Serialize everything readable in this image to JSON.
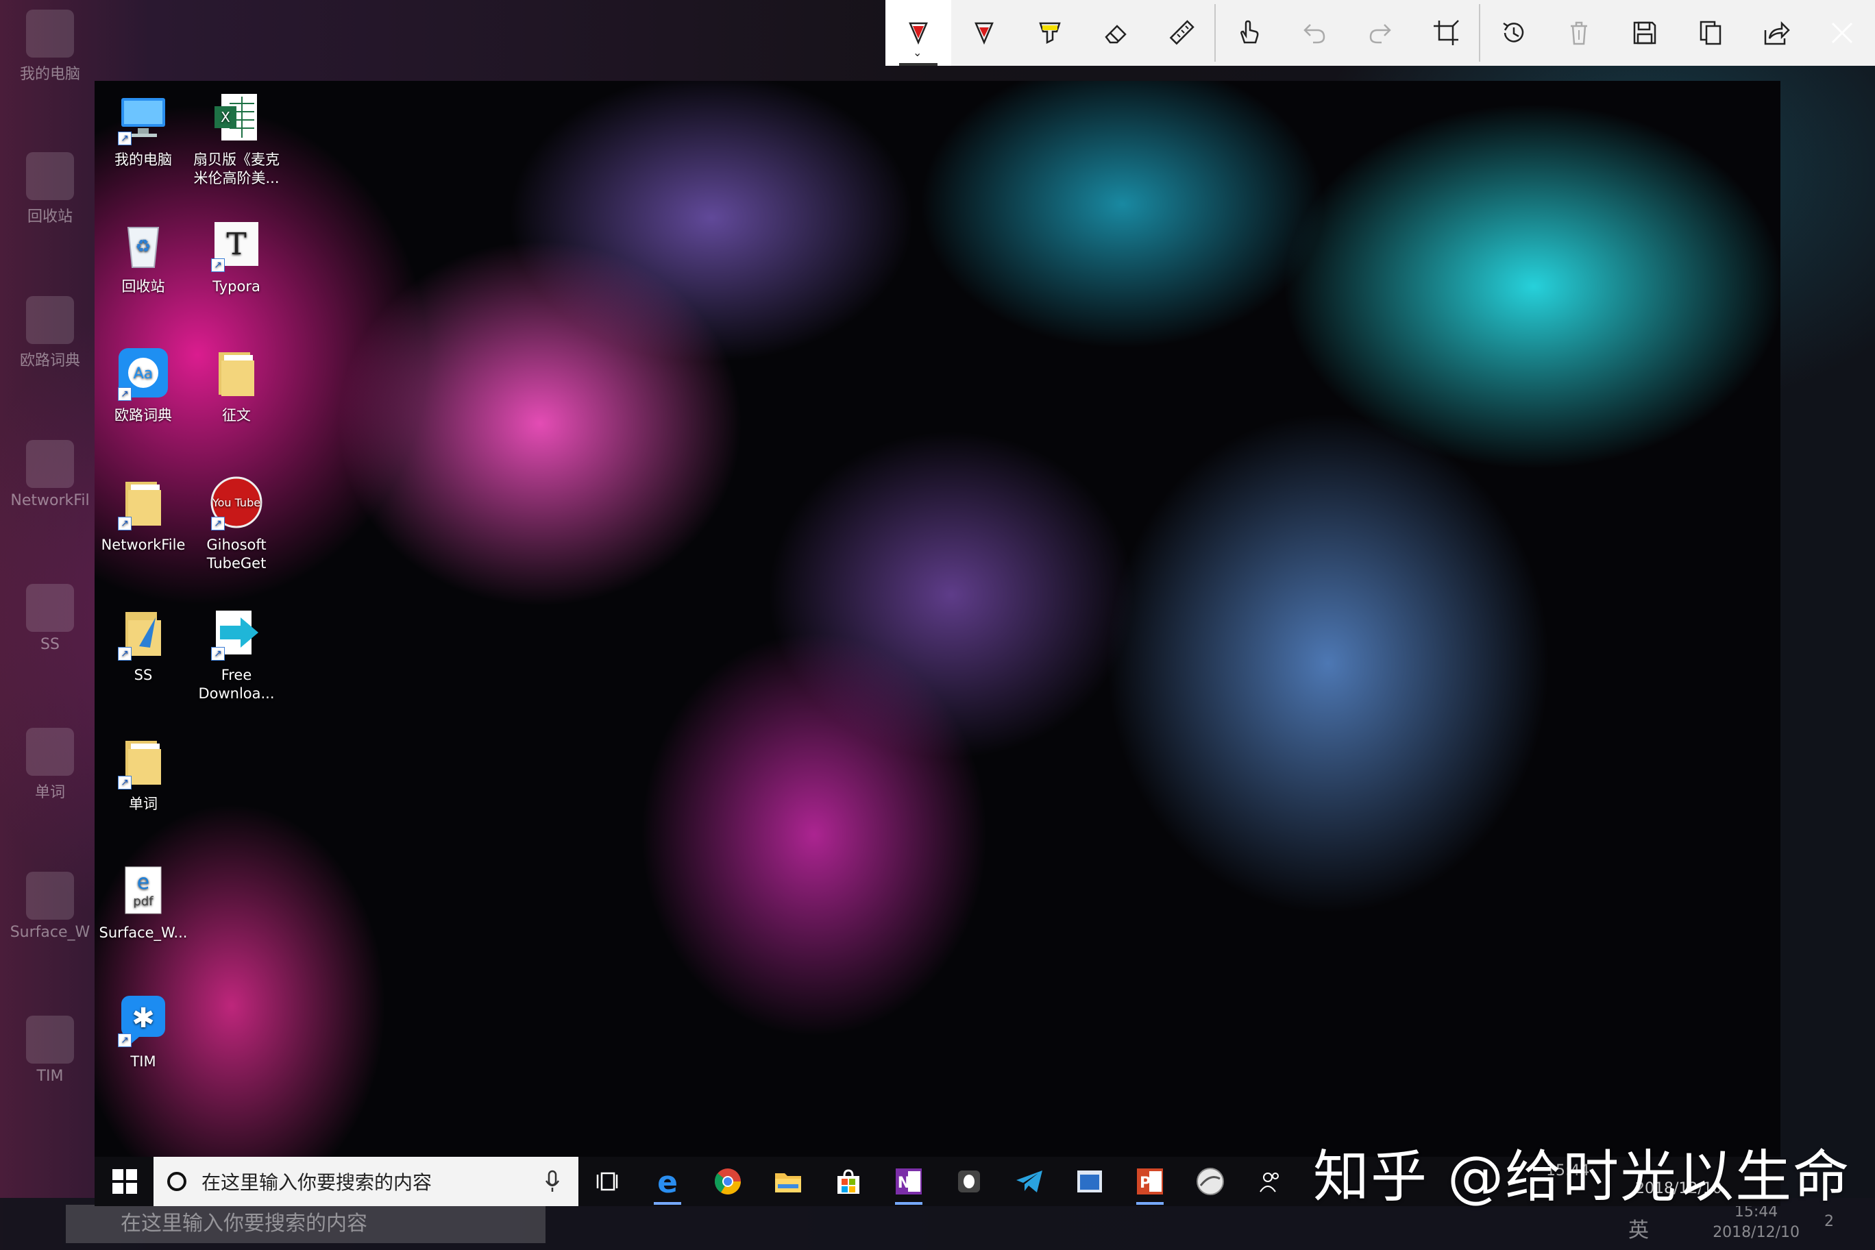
{
  "outer_desktop": {
    "icons": [
      {
        "label": "我的电脑"
      },
      {
        "label": "回收站"
      },
      {
        "label": "欧路词典"
      },
      {
        "label": "NetworkFil"
      },
      {
        "label": "SS"
      },
      {
        "label": "单词"
      },
      {
        "label": "Surface_W"
      },
      {
        "label": "TIM"
      }
    ],
    "taskbar": {
      "search_placeholder": "在这里输入你要搜索的内容",
      "ime": "英",
      "clock_time": "15:44",
      "clock_date": "2018/12/10",
      "notifications": "2"
    }
  },
  "toolbar": {
    "buttons": [
      {
        "name": "ballpoint-pen-button",
        "icon": "ballpoint-pen-icon",
        "color": "#d81b1b",
        "active": true
      },
      {
        "name": "pencil-button",
        "icon": "pencil-icon",
        "color": "#d81b1b"
      },
      {
        "name": "highlighter-button",
        "icon": "highlighter-icon",
        "color": "#f5e000"
      },
      {
        "name": "eraser-button",
        "icon": "eraser-icon"
      },
      {
        "name": "ruler-button",
        "icon": "ruler-icon"
      },
      {
        "name": "touch-writing-button",
        "icon": "touch-writing-icon"
      },
      {
        "name": "undo-button",
        "icon": "undo-icon",
        "disabled": true
      },
      {
        "name": "redo-button",
        "icon": "redo-icon",
        "disabled": true
      },
      {
        "name": "crop-button",
        "icon": "crop-icon"
      },
      {
        "name": "history-button",
        "icon": "history-icon"
      },
      {
        "name": "delete-button",
        "icon": "delete-icon",
        "disabled": true
      },
      {
        "name": "save-button",
        "icon": "save-icon"
      },
      {
        "name": "copy-button",
        "icon": "copy-icon"
      },
      {
        "name": "share-button",
        "icon": "share-icon"
      }
    ],
    "close_icon": "close-icon"
  },
  "capture": {
    "desktop_icons": [
      {
        "name": "my-computer",
        "label_lines": [
          "我的电脑"
        ],
        "icon": "computer-icon"
      },
      {
        "name": "excel-file",
        "label_lines": [
          "扇贝版《麦克",
          "米伦高阶美..."
        ],
        "icon": "excel-icon"
      },
      {
        "name": "recycle-bin",
        "label_lines": [
          "回收站"
        ],
        "icon": "recycle-bin-icon"
      },
      {
        "name": "typora",
        "label_lines": [
          "Typora"
        ],
        "icon": "typora-icon",
        "glyph": "T"
      },
      {
        "name": "eudic",
        "label_lines": [
          "欧路词典"
        ],
        "icon": "eudic-icon",
        "glyph": "Aa"
      },
      {
        "name": "zhengwen-folder",
        "label_lines": [
          "征文"
        ],
        "icon": "folder-icon"
      },
      {
        "name": "networkfile-folder",
        "label_lines": [
          "NetworkFile"
        ],
        "icon": "folder-icon"
      },
      {
        "name": "gihosoft",
        "label_lines": [
          "Gihosoft",
          "TubeGet"
        ],
        "icon": "youtube-icon",
        "glyph": "You Tube"
      },
      {
        "name": "ss-folder",
        "label_lines": [
          "SS"
        ],
        "icon": "folder-icon"
      },
      {
        "name": "free-download",
        "label_lines": [
          "Free",
          "Downloa..."
        ],
        "icon": "download-arrow-icon"
      },
      {
        "name": "danci-folder",
        "label_lines": [
          "单词"
        ],
        "icon": "folder-icon"
      },
      {
        "name": "surface-pdf",
        "label_lines": [
          "Surface_W..."
        ],
        "icon": "pdf-icon",
        "glyph": "pdf"
      },
      {
        "name": "tim",
        "label_lines": [
          "TIM"
        ],
        "icon": "tim-icon"
      }
    ],
    "taskbar": {
      "search_placeholder": "在这里输入你要搜索的内容",
      "apps": [
        {
          "name": "task-view",
          "icon": "task-view-icon"
        },
        {
          "name": "edge",
          "icon": "edge-icon",
          "running": true
        },
        {
          "name": "chrome",
          "icon": "chrome-icon"
        },
        {
          "name": "file-explorer",
          "icon": "folder-icon"
        },
        {
          "name": "store",
          "icon": "store-icon"
        },
        {
          "name": "onenote",
          "icon": "onenote-icon",
          "running": true
        },
        {
          "name": "qq",
          "icon": "qq-icon"
        },
        {
          "name": "telegram",
          "icon": "telegram-icon"
        },
        {
          "name": "app-window",
          "icon": "window-icon"
        },
        {
          "name": "powerpoint",
          "icon": "powerpoint-icon",
          "running": true
        },
        {
          "name": "app-round",
          "icon": "globe-icon"
        },
        {
          "name": "people",
          "icon": "people-icon"
        }
      ],
      "clock_time": "15:44",
      "clock_date": "2018/12/10"
    }
  },
  "watermark": "知乎 @给时光以生命"
}
